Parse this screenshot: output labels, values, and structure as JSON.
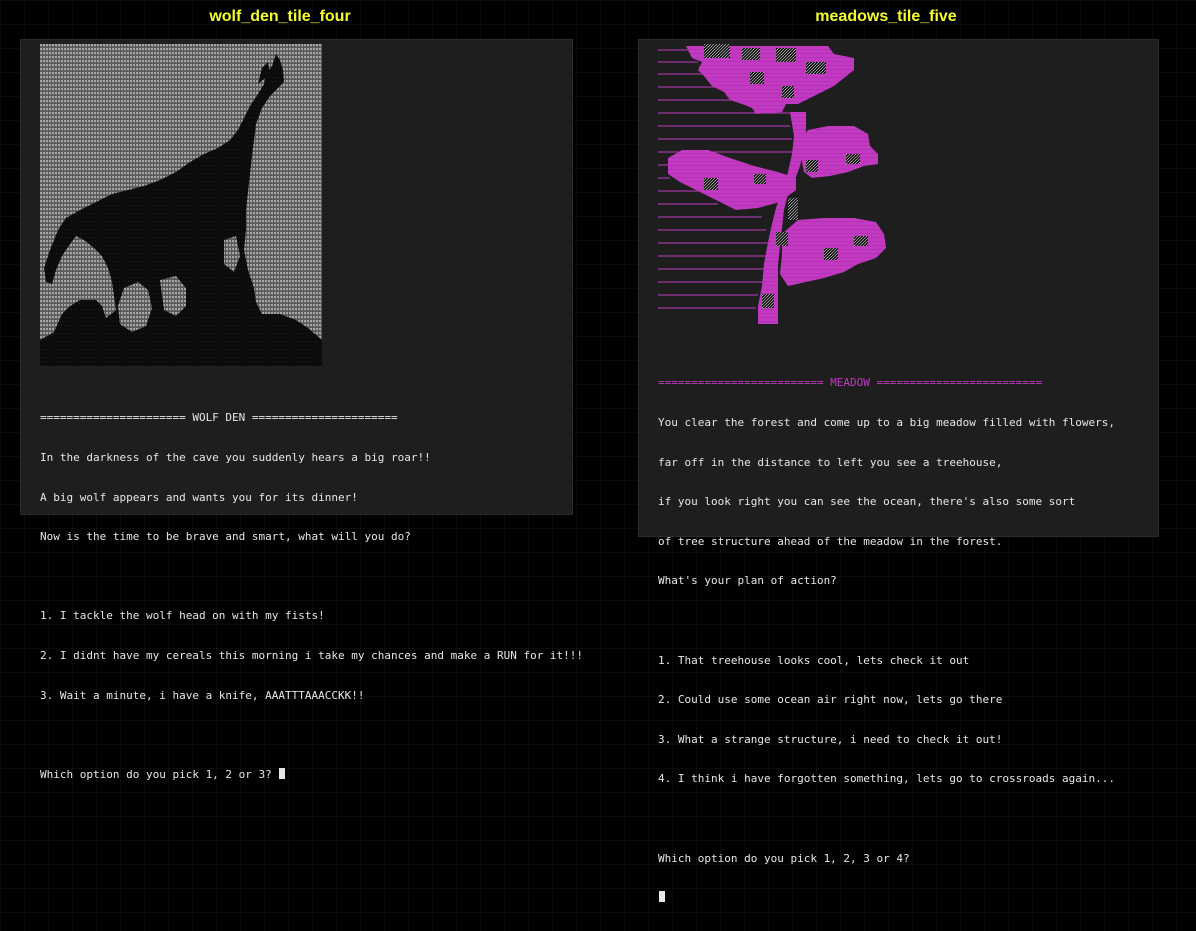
{
  "captions": {
    "left": "wolf_den_tile_four",
    "right": "meadows_tile_five"
  },
  "colors": {
    "caption": "#f5ff2e",
    "terminal_bg": "#1e1e1e",
    "terminal_text": "#e6e6e6",
    "meadow_accent": "#c13ac1",
    "wolf_art_light": "#8d8d8d",
    "wolf_silhouette": "#0b0b0b"
  },
  "wolf_den": {
    "art": "wolf-howling-ascii-art",
    "header": "====================== WOLF DEN ======================",
    "story": [
      "In the darkness of the cave you suddenly hears a big roar!!",
      "A big wolf appears and wants you for its dinner!",
      "Now is the time to be brave and smart, what will you do?"
    ],
    "options": [
      "1. I tackle the wolf head on with my fists!",
      "2. I didnt have my cereals this morning i take my chances and make a RUN for it!!!",
      "3. Wait a minute, i have a knife, AAATTTAAACCKK!!"
    ],
    "prompt": "Which option do you pick 1, 2 or 3? "
  },
  "meadows": {
    "art": "flowering-branch-ascii-art",
    "header": "========================= MEADOW =========================",
    "story": [
      "You clear the forest and come up to a big meadow filled with flowers,",
      "far off in the distance to left you see a treehouse,",
      "if you look right you can see the ocean, there's also some sort",
      "of tree structure ahead of the meadow in the forest.",
      "What's your plan of action?"
    ],
    "options": [
      "1. That treehouse looks cool, lets check it out",
      "2. Could use some ocean air right now, lets go there",
      "3. What a strange structure, i need to check it out!",
      "4. I think i have forgotten something, lets go to crossroads again..."
    ],
    "prompt": "Which option do you pick 1, 2, 3 or 4?"
  }
}
